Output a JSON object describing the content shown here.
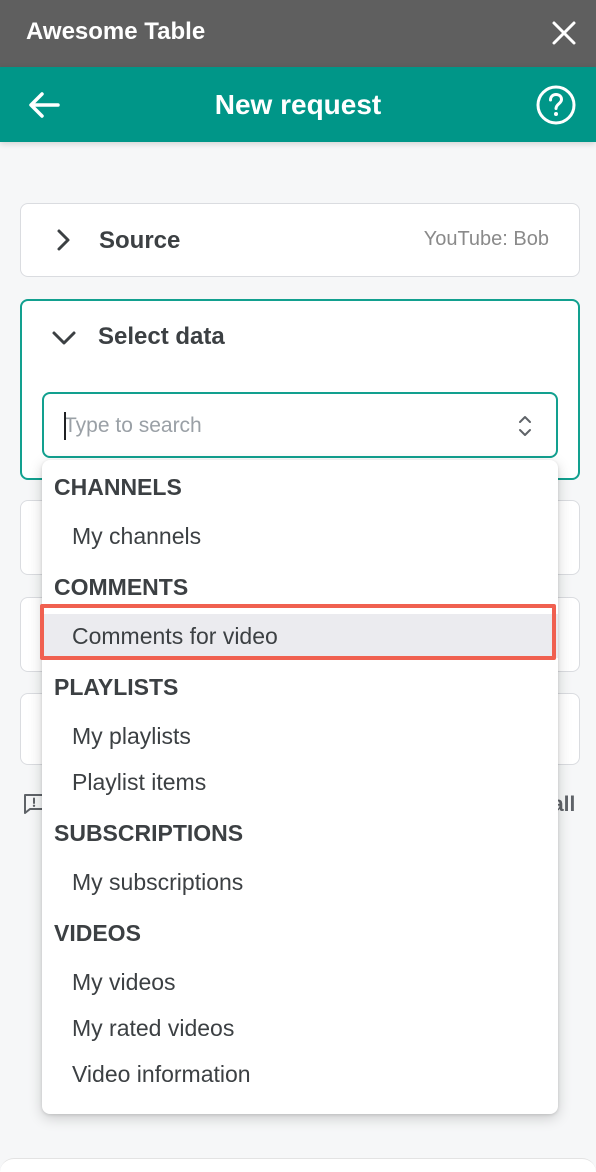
{
  "window": {
    "app_title": "Awesome Table"
  },
  "header": {
    "title": "New request"
  },
  "source": {
    "label": "Source",
    "value": "YouTube: Bob"
  },
  "select_data": {
    "label": "Select data"
  },
  "search": {
    "placeholder": "Type to search",
    "value": ""
  },
  "hidden_link": {
    "label": "all"
  },
  "dropdown": {
    "groups": [
      {
        "label": "CHANNELS",
        "options": [
          "My channels"
        ]
      },
      {
        "label": "COMMENTS",
        "options": [
          "Comments for video"
        ]
      },
      {
        "label": "PLAYLISTS",
        "options": [
          "My playlists",
          "Playlist items"
        ]
      },
      {
        "label": "SUBSCRIPTIONS",
        "options": [
          "My subscriptions"
        ]
      },
      {
        "label": "VIDEOS",
        "options": [
          "My videos",
          "My rated videos",
          "Video information"
        ]
      }
    ],
    "highlighted_option": "Comments for video"
  },
  "colors": {
    "titlebar": "#5f5f5f",
    "header": "#009688",
    "accent_border": "#12a08f",
    "highlight_frame": "#f06050",
    "highlight_bg": "#ebebef"
  },
  "icons": {
    "close": "close-icon",
    "back": "arrow-left-icon",
    "help": "help-circle-icon",
    "source_chevron": "chevron-right-icon",
    "select_chevron": "chevron-down-icon",
    "select_arrows": "unfold-icon",
    "feedback": "feedback-icon"
  }
}
